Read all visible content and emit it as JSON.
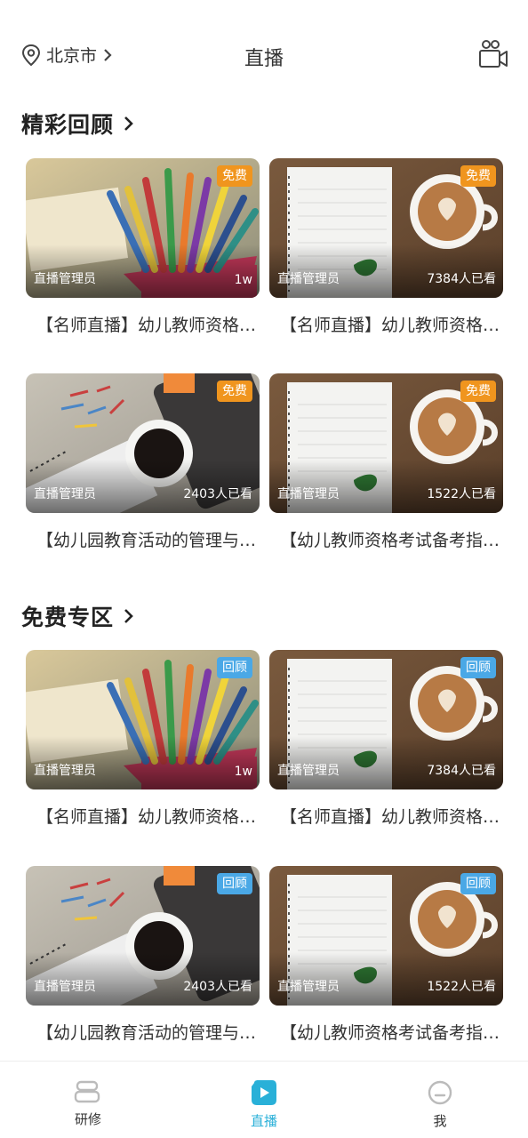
{
  "header": {
    "location": "北京市",
    "title": "直播"
  },
  "sections": [
    {
      "title": "精彩回顾",
      "cards": [
        {
          "badge": "免费",
          "author": "直播管理员",
          "views": "1w",
          "title": "【名师直播】幼儿教师资格考试备考指导"
        },
        {
          "badge": "免费",
          "author": "直播管理员",
          "views": "7384人已看",
          "title": "【名师直播】幼儿教师资格考试备考指导"
        },
        {
          "badge": "免费",
          "author": "直播管理员",
          "views": "2403人已看",
          "title": "【幼儿园教育活动的管理与实施】"
        },
        {
          "badge": "免费",
          "author": "直播管理员",
          "views": "1522人已看",
          "title": "【幼儿教师资格考试备考指导】"
        }
      ]
    },
    {
      "title": "免费专区",
      "cards": [
        {
          "badge": "回顾",
          "author": "直播管理员",
          "views": "1w",
          "title": "【名师直播】幼儿教师资格考试备考指导"
        },
        {
          "badge": "回顾",
          "author": "直播管理员",
          "views": "7384人已看",
          "title": "【名师直播】幼儿教师资格考试备考指导"
        },
        {
          "badge": "回顾",
          "author": "直播管理员",
          "views": "2403人已看",
          "title": "【幼儿园教育活动的管理与实施】"
        },
        {
          "badge": "回顾",
          "author": "直播管理员",
          "views": "1522人已看",
          "title": "【幼儿教师资格考试备考指导】"
        }
      ]
    }
  ],
  "tabbar": {
    "items": [
      {
        "label": "研修",
        "icon": "books-icon"
      },
      {
        "label": "直播",
        "icon": "play-icon",
        "active": true
      },
      {
        "label": "我",
        "icon": "user-face-icon"
      }
    ]
  },
  "colors": {
    "free_badge": "#f0951e",
    "review_badge": "#4aa8e6",
    "accent": "#29b0d8"
  }
}
